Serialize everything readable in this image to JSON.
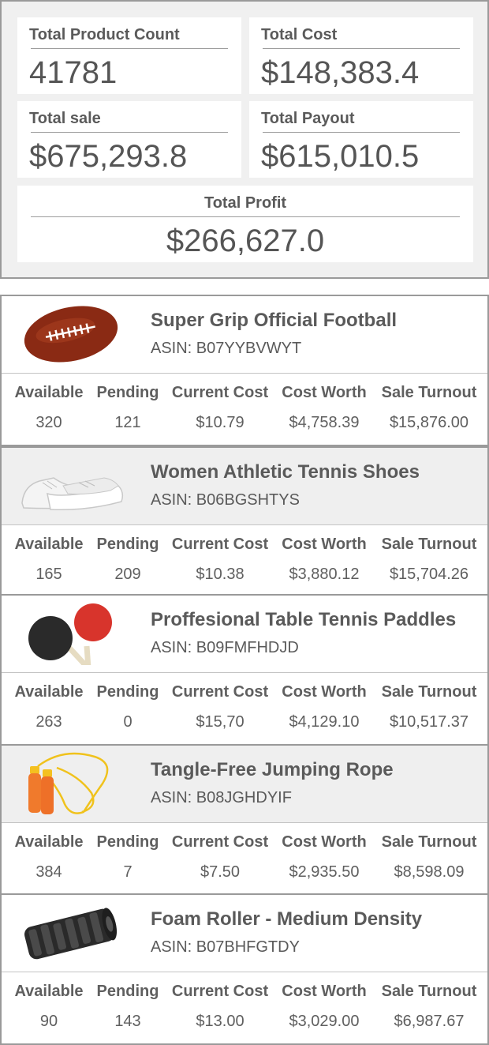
{
  "summary": {
    "total_product_count": {
      "label": "Total Product Count",
      "value": "41781"
    },
    "total_cost": {
      "label": "Total Cost",
      "value": "$148,383.4"
    },
    "total_sale": {
      "label": "Total sale",
      "value": "$675,293.8"
    },
    "total_payout": {
      "label": "Total Payout",
      "value": "$615,010.5"
    },
    "total_profit": {
      "label": "Total Profit",
      "value": "$266,627.0"
    }
  },
  "metric_labels": {
    "available": "Available",
    "pending": "Pending",
    "current_cost": "Current Cost",
    "cost_worth": "Cost Worth",
    "sale_turnout": "Sale Turnout"
  },
  "products": [
    {
      "title": "Super Grip Official Football",
      "asin": "ASIN: B07YYBVWYT",
      "icon": "football-icon",
      "available": "320",
      "pending": "121",
      "current_cost": "$10.79",
      "cost_worth": "$4,758.39",
      "sale_turnout": "$15,876.00"
    },
    {
      "title": "Women Athletic Tennis Shoes",
      "asin": "ASIN: B06BGSHTYS",
      "icon": "sneakers-icon",
      "available": "165",
      "pending": "209",
      "current_cost": "$10.38",
      "cost_worth": "$3,880.12",
      "sale_turnout": "$15,704.26"
    },
    {
      "title": "Proffesional Table Tennis Paddles",
      "asin": "ASIN: B09FMFHDJD",
      "icon": "ping-pong-paddles-icon",
      "available": "263",
      "pending": "0",
      "current_cost": "$15,70",
      "cost_worth": "$4,129.10",
      "sale_turnout": "$10,517.37"
    },
    {
      "title": "Tangle-Free Jumping Rope",
      "asin": "ASIN: B08JGHDYIF",
      "icon": "jump-rope-icon",
      "available": "384",
      "pending": "7",
      "current_cost": "$7.50",
      "cost_worth": "$2,935.50",
      "sale_turnout": "$8,598.09"
    },
    {
      "title": "Foam Roller - Medium Density",
      "asin": "ASIN: B07BHFGTDY",
      "icon": "foam-roller-icon",
      "available": "90",
      "pending": "143",
      "current_cost": "$13.00",
      "cost_worth": "$3,029.00",
      "sale_turnout": "$6,987.67"
    }
  ]
}
